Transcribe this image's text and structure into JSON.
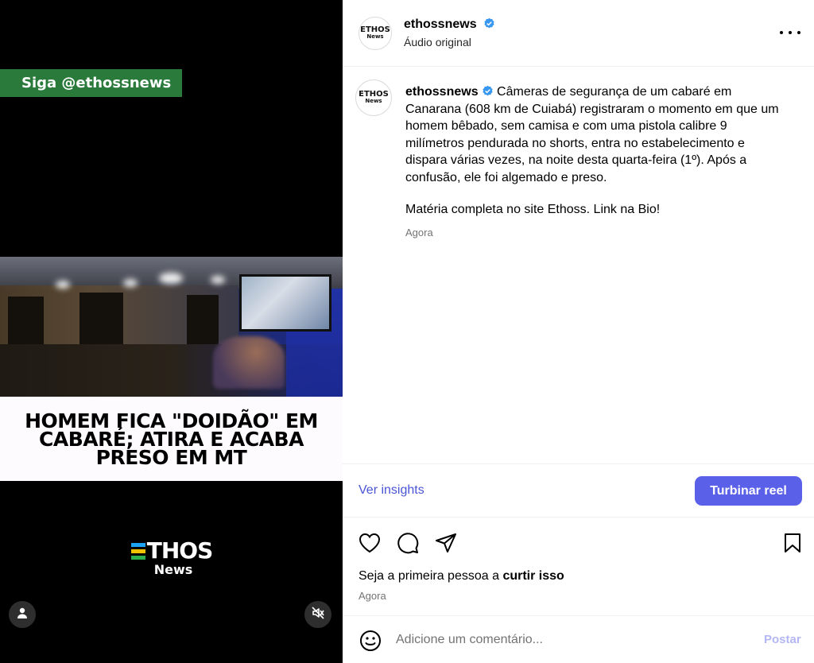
{
  "video": {
    "follow_banner": "Siga @ethossnews",
    "headline_lines": [
      "HOMEM FICA \"DOIDÃO\" EM",
      "CABARÉ; ATIRA E ACABA",
      "PRESO EM MT"
    ],
    "logo_text": "THOS",
    "logo_sub": "News",
    "logo_bar_colors": [
      "#1da1f2",
      "#f2c200",
      "#2fae4e"
    ],
    "profile_button_icon": "person-icon",
    "mute_button_icon": "speaker-muted-icon"
  },
  "header": {
    "avatar_text": "ETHOS",
    "avatar_sub": "News",
    "username": "ethossnews",
    "verified_icon": "verified-badge-icon",
    "audio_label": "Áudio original",
    "more_icon": "more-options-icon"
  },
  "caption": {
    "username": "ethossnews",
    "text": "Câmeras de segurança de um cabaré em Canarana (608 km de Cuiabá) registraram o momento em que um homem bêbado, sem camisa e com uma pistola calibre 9 milímetros pendurada no shorts, entra no estabelecimento e dispara várias vezes, na noite desta quarta-feira (1º). Após a confusão, ele foi algemado e preso.",
    "text2": "Matéria completa no site Ethoss. Link na Bio!",
    "time": "Agora"
  },
  "insights": {
    "link": "Ver insights",
    "boost_button": "Turbinar reel",
    "accent_color": "#5b60e8"
  },
  "actions": {
    "like_icon": "heart-icon",
    "comment_icon": "comment-icon",
    "share_icon": "send-icon",
    "save_icon": "bookmark-icon",
    "likes_prefix": "Seja a primeira pessoa a ",
    "likes_link": "curtir isso",
    "time": "Agora"
  },
  "comment": {
    "emoji_icon": "smiley-icon",
    "placeholder": "Adicione um comentário...",
    "post_button": "Postar"
  }
}
